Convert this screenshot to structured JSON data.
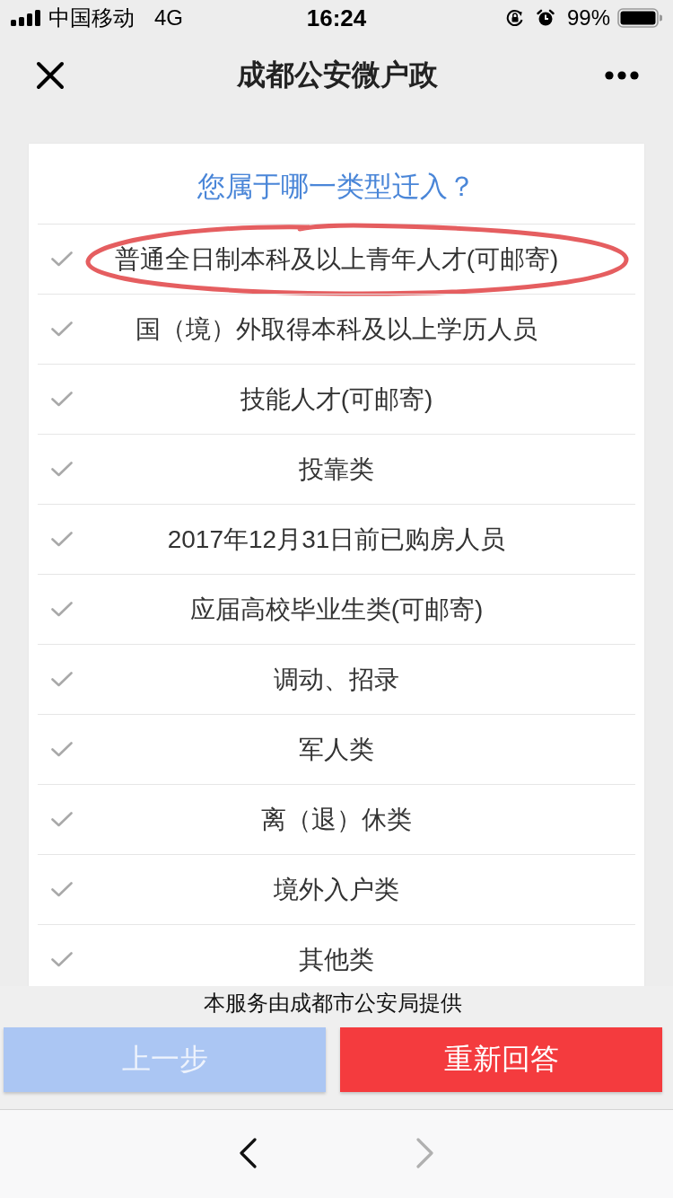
{
  "status_bar": {
    "carrier": "中国移动",
    "network": "4G",
    "time": "16:24",
    "battery": "99%"
  },
  "nav_bar": {
    "title": "成都公安微户政"
  },
  "question": {
    "title": "您属于哪一类型迁入？"
  },
  "options": [
    {
      "label": "普通全日制本科及以上青年人才(可邮寄)",
      "selected": false,
      "circled": true
    },
    {
      "label": "国（境）外取得本科及以上学历人员",
      "selected": false,
      "circled": false
    },
    {
      "label": "技能人才(可邮寄)",
      "selected": false,
      "circled": false
    },
    {
      "label": "投靠类",
      "selected": false,
      "circled": false
    },
    {
      "label": "2017年12月31日前已购房人员",
      "selected": false,
      "circled": false
    },
    {
      "label": "应届高校毕业生类(可邮寄)",
      "selected": false,
      "circled": false
    },
    {
      "label": "调动、招录",
      "selected": false,
      "circled": false
    },
    {
      "label": "军人类",
      "selected": false,
      "circled": false
    },
    {
      "label": "离（退）休类",
      "selected": false,
      "circled": false
    },
    {
      "label": "境外入户类",
      "selected": false,
      "circled": false
    },
    {
      "label": "其他类",
      "selected": false,
      "circled": false
    }
  ],
  "footer": {
    "provider": "本服务由成都市公安局提供",
    "buttons": [
      {
        "label": "上一步",
        "kind": "secondary",
        "disabled": true
      },
      {
        "label": "重新回答",
        "kind": "primary",
        "disabled": false
      }
    ]
  },
  "browser_toolbar": {
    "back": {
      "disabled": false
    },
    "forward": {
      "disabled": true
    }
  }
}
